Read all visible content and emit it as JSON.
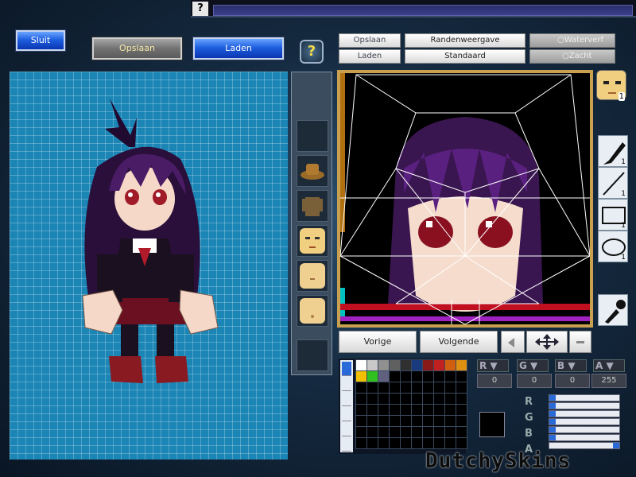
{
  "top": {
    "help_glyph": "?"
  },
  "left_buttons": {
    "close": "Sluit",
    "save": "Opslaan",
    "load": "Laden",
    "help": "?"
  },
  "editor_buttons": {
    "save": "Opslaan",
    "load": "Laden",
    "edge_view": "Randenweergave",
    "standard": "Standaard",
    "watercolor": "Waterverf",
    "soft": "Zacht"
  },
  "nav": {
    "prev": "Vorige",
    "next": "Volgende"
  },
  "tools": [
    {
      "icon": "brush-icon",
      "count": "1"
    },
    {
      "icon": "line-icon",
      "count": "1"
    },
    {
      "icon": "rectangle-icon",
      "count": "1"
    },
    {
      "icon": "ellipse-icon",
      "count": "1"
    },
    {
      "icon": "eyedropper-icon"
    }
  ],
  "face_count": "1",
  "channels": [
    {
      "label": "R",
      "value": "0"
    },
    {
      "label": "G",
      "value": "0"
    },
    {
      "label": "B",
      "value": "0"
    },
    {
      "label": "A",
      "value": "255"
    }
  ],
  "slider_labels": [
    "R",
    "G",
    "B",
    "A"
  ],
  "slider_levels": [
    0,
    0,
    0,
    1
  ],
  "palette_colors": [
    "#ffffff",
    "#c8c8c8",
    "#909090",
    "#606060",
    "#303030",
    "#1a3a80",
    "#8a1a1a",
    "#c02020",
    "#d06010",
    "#e09010",
    "#f0c000",
    "#30c020",
    "#606080",
    "#000000",
    "#000000",
    "#000000",
    "#000000",
    "#000000",
    "#000000",
    "#000000"
  ],
  "current_color": "#000000",
  "watermark": "DutchySkins"
}
